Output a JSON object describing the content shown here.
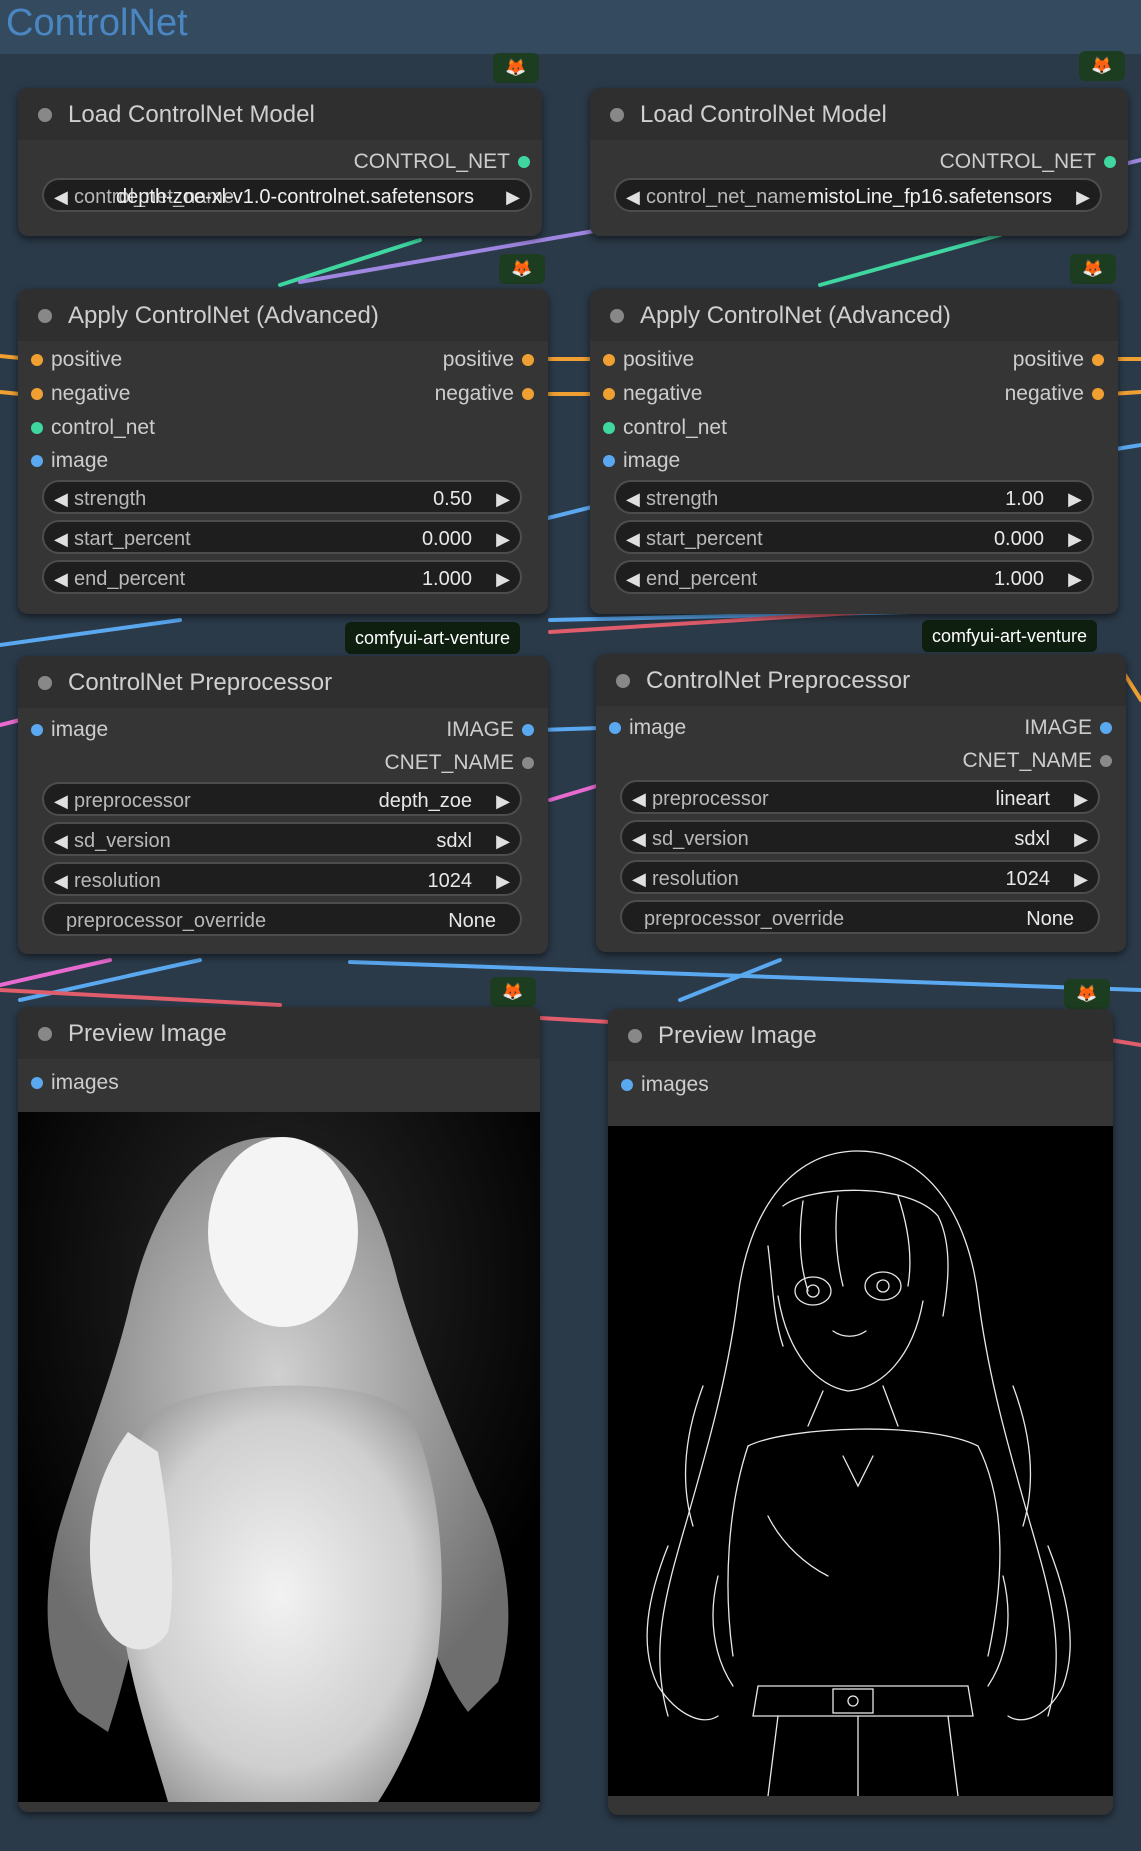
{
  "group": {
    "title": "ControlNet"
  },
  "badges": {
    "fox_icon": "🦊",
    "tag": "comfyui-art-venture"
  },
  "colors": {
    "positive": "#f0a032",
    "control_net": "#3fd6a0",
    "image": "#5aa8f0",
    "cnet_name": "#8a8a8a"
  },
  "left": {
    "load_model": {
      "title": "Load ControlNet Model",
      "output": "CONTROL_NET",
      "widget_label": "control_net_name",
      "widget_value": "depth-zoe-xl-v1.0-controlnet.safetensors"
    },
    "apply": {
      "title": "Apply ControlNet (Advanced)",
      "inputs": [
        "positive",
        "negative",
        "control_net",
        "image"
      ],
      "outputs": [
        "positive",
        "negative"
      ],
      "widgets": [
        {
          "label": "strength",
          "value": "0.50"
        },
        {
          "label": "start_percent",
          "value": "0.000"
        },
        {
          "label": "end_percent",
          "value": "1.000"
        }
      ]
    },
    "preprocessor": {
      "title": "ControlNet Preprocessor",
      "input": "image",
      "outputs": [
        "IMAGE",
        "CNET_NAME"
      ],
      "widgets": [
        {
          "label": "preprocessor",
          "value": "depth_zoe"
        },
        {
          "label": "sd_version",
          "value": "sdxl"
        },
        {
          "label": "resolution",
          "value": "1024"
        },
        {
          "label": "preprocessor_override",
          "value": "None"
        }
      ]
    },
    "preview": {
      "title": "Preview Image",
      "input": "images"
    }
  },
  "right": {
    "load_model": {
      "title": "Load ControlNet Model",
      "output": "CONTROL_NET",
      "widget_label": "control_net_name",
      "widget_value": "mistoLine_fp16.safetensors"
    },
    "apply": {
      "title": "Apply ControlNet (Advanced)",
      "inputs": [
        "positive",
        "negative",
        "control_net",
        "image"
      ],
      "outputs": [
        "positive",
        "negative"
      ],
      "widgets": [
        {
          "label": "strength",
          "value": "1.00"
        },
        {
          "label": "start_percent",
          "value": "0.000"
        },
        {
          "label": "end_percent",
          "value": "1.000"
        }
      ]
    },
    "preprocessor": {
      "title": "ControlNet Preprocessor",
      "input": "image",
      "outputs": [
        "IMAGE",
        "CNET_NAME"
      ],
      "widgets": [
        {
          "label": "preprocessor",
          "value": "lineart"
        },
        {
          "label": "sd_version",
          "value": "sdxl"
        },
        {
          "label": "resolution",
          "value": "1024"
        },
        {
          "label": "preprocessor_override",
          "value": "None"
        }
      ]
    },
    "preview": {
      "title": "Preview Image",
      "input": "images"
    }
  }
}
